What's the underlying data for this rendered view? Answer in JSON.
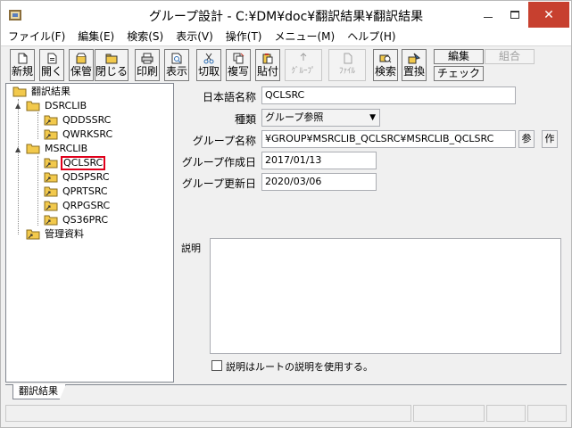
{
  "window": {
    "title": "グループ設計 - C:¥DM¥doc¥翻訳結果¥翻訳結果",
    "close_glyph": "✕"
  },
  "menubar": {
    "items": [
      {
        "label": "ファイル(F)"
      },
      {
        "label": "編集(E)"
      },
      {
        "label": "検索(S)"
      },
      {
        "label": "表示(V)"
      },
      {
        "label": "操作(T)"
      },
      {
        "label": "メニュー(M)"
      },
      {
        "label": "ヘルプ(H)"
      }
    ]
  },
  "toolbar": {
    "new": "新規",
    "open": "開く",
    "save": "保管",
    "close": "閉じる",
    "print": "印刷",
    "view": "表示",
    "cut": "切取",
    "copy": "複写",
    "paste": "貼付",
    "group": "ｸﾞﾙｰﾌﾟ",
    "file": "ﾌｧｲﾙ",
    "search": "検索",
    "replace": "置換",
    "edit": "編集",
    "combine": "組合",
    "check": "チェック",
    "colors": {
      "folder_yellow": "#f2c94c",
      "arrow_red": "#c0392b",
      "icon_blue": "#2c6db3"
    }
  },
  "tree": {
    "root": "翻訳結果",
    "nodes": [
      {
        "label": "DSRCLIB",
        "expander": "▲"
      },
      {
        "label": "QDDSSRC"
      },
      {
        "label": "QWRKSRC"
      },
      {
        "label": "MSRCLIB",
        "expander": "▲"
      },
      {
        "label": "QCLSRC",
        "selected": true
      },
      {
        "label": "QDSPSRC"
      },
      {
        "label": "QPRTSRC"
      },
      {
        "label": "QRPGSRC"
      },
      {
        "label": "QS36PRC"
      },
      {
        "label": "管理資料"
      }
    ],
    "tab_label": "翻訳結果"
  },
  "form": {
    "jp_name_label": "日本語名称",
    "jp_name_value": "QCLSRC",
    "kind_label": "種類",
    "kind_value": "グループ参照",
    "group_name_label": "グループ名称",
    "group_name_value": "¥GROUP¥MSRCLIB_QCLSRC¥MSRCLIB_QCLSRC",
    "ref_btn": "参",
    "make_btn": "作",
    "created_label": "グループ作成日",
    "created_value": "2017/01/13",
    "updated_label": "グループ更新日",
    "updated_value": "2020/03/06",
    "desc_label": "説明",
    "desc_value": "",
    "use_root_desc_label": "説明はルートの説明を使用する。",
    "use_root_desc_checked": false
  }
}
